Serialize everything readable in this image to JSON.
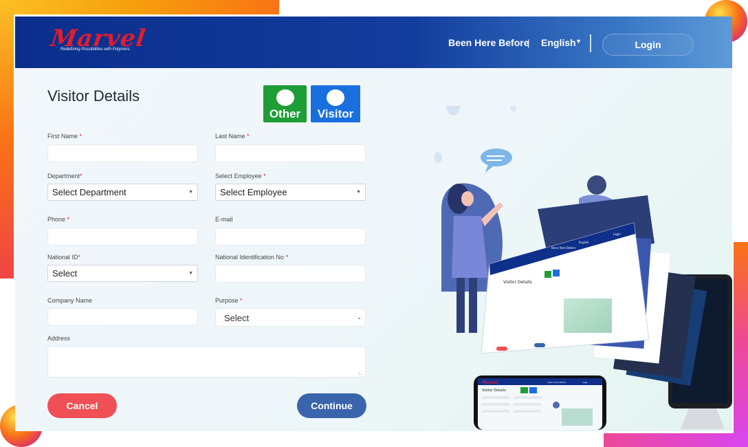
{
  "brand": {
    "name": "Marvel",
    "tagline": "Redefining Possibilities with Polymers"
  },
  "nav": {
    "been_here_before": "Been Here Before",
    "separator": "|",
    "language": "English",
    "login": "Login"
  },
  "form": {
    "title": "Visitor Details",
    "visitor_types": [
      {
        "label": "Other",
        "color": "#1f9d36"
      },
      {
        "label": "Visitor",
        "color": "#1a6fde"
      }
    ],
    "required_mark": "*",
    "fields": {
      "first_name": {
        "label": "First Name",
        "required": true,
        "value": ""
      },
      "last_name": {
        "label": "Last Name",
        "required": true,
        "value": ""
      },
      "department": {
        "label": "Department",
        "required": true,
        "selected": "Select Department"
      },
      "employee": {
        "label": "Select Employee",
        "required": true,
        "selected": "Select Employee"
      },
      "phone": {
        "label": "Phone",
        "required": true,
        "value": ""
      },
      "email": {
        "label": "E-mail",
        "required": false,
        "value": ""
      },
      "national_id": {
        "label": "National ID",
        "required": true,
        "selected": "Select"
      },
      "national_id_no": {
        "label": "National Identification No",
        "required": true,
        "value": ""
      },
      "company": {
        "label": "Company Name",
        "required": false,
        "value": ""
      },
      "purpose": {
        "label": "Purpose",
        "required": true,
        "selected": "Select"
      },
      "address": {
        "label": "Address",
        "required": false,
        "value": ""
      }
    },
    "buttons": {
      "cancel": "Cancel",
      "continue": "Continue"
    }
  },
  "colors": {
    "header_blue": "#0b2e8c",
    "cancel_red": "#ef4f55",
    "continue_blue": "#3a64ac",
    "brand_red": "#e11d2e"
  },
  "mockups": {
    "title": "Visitor Details",
    "other": "Other",
    "visitor": "Visitor",
    "been_here_before": "Been Here Before",
    "english": "English",
    "login": "Login"
  }
}
